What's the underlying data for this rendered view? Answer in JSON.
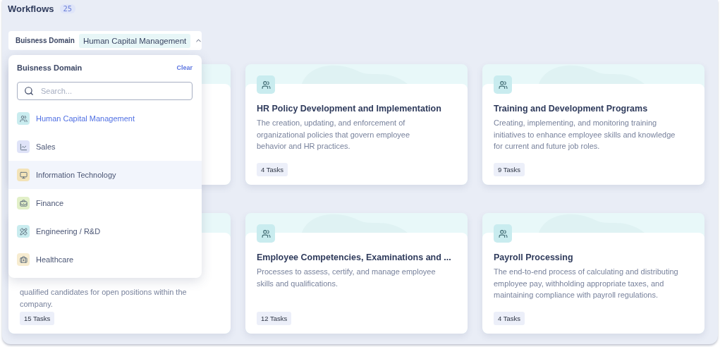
{
  "header": {
    "title": "Workflows",
    "count": "25"
  },
  "filter": {
    "label": "Buisness Domain",
    "value": "Human Capital Management",
    "expanded": true
  },
  "dropdown": {
    "title": "Buisness Domain",
    "clear": "Clear",
    "search_placeholder": "Search...",
    "items": [
      {
        "label": "Human Capital Management",
        "kind": "users",
        "color": "#c9ecef",
        "selected": true,
        "hovered": false
      },
      {
        "label": "Sales",
        "kind": "chart",
        "color": "#dfe3f8",
        "selected": false,
        "hovered": false
      },
      {
        "label": "Information Technology",
        "kind": "monitor",
        "color": "#f3e3b8",
        "selected": false,
        "hovered": true
      },
      {
        "label": "Finance",
        "kind": "finance",
        "color": "#e2f0c8",
        "selected": false,
        "hovered": false
      },
      {
        "label": "Engineering / R&D",
        "kind": "tools",
        "color": "#c9ecef",
        "selected": false,
        "hovered": false
      },
      {
        "label": "Healthcare",
        "kind": "medical",
        "color": "#f7ecd0",
        "selected": false,
        "hovered": false
      }
    ]
  },
  "cards": [
    {
      "kind": "covered"
    },
    {
      "kind": "full",
      "title": "HR Policy Development and Implementation",
      "description": "The creation, updating, and enforcement of organizational policies that govern employee behavior and HR practices.",
      "tasks": "4 Tasks"
    },
    {
      "kind": "full",
      "title": "Training and Development Programs",
      "description": "Creating, implementing, and monitoring training initiatives to enhance employee skills and knowledge for current and future job roles.",
      "tasks": "9 Tasks"
    },
    {
      "kind": "covered",
      "description": "qualified candidates for open positions within the company.",
      "tasks": "15 Tasks"
    },
    {
      "kind": "full",
      "title": "Employee Competencies, Examinations and ...",
      "description": "Processes to assess, certify, and manage employee skills and qualifications.",
      "tasks": "12 Tasks"
    },
    {
      "kind": "full",
      "title": "Payroll Processing",
      "description": "The end-to-end process of calculating and distributing employee pay, withholding appropriate taxes, and maintaining compliance with payroll regulations.",
      "tasks": "4 Tasks"
    }
  ]
}
